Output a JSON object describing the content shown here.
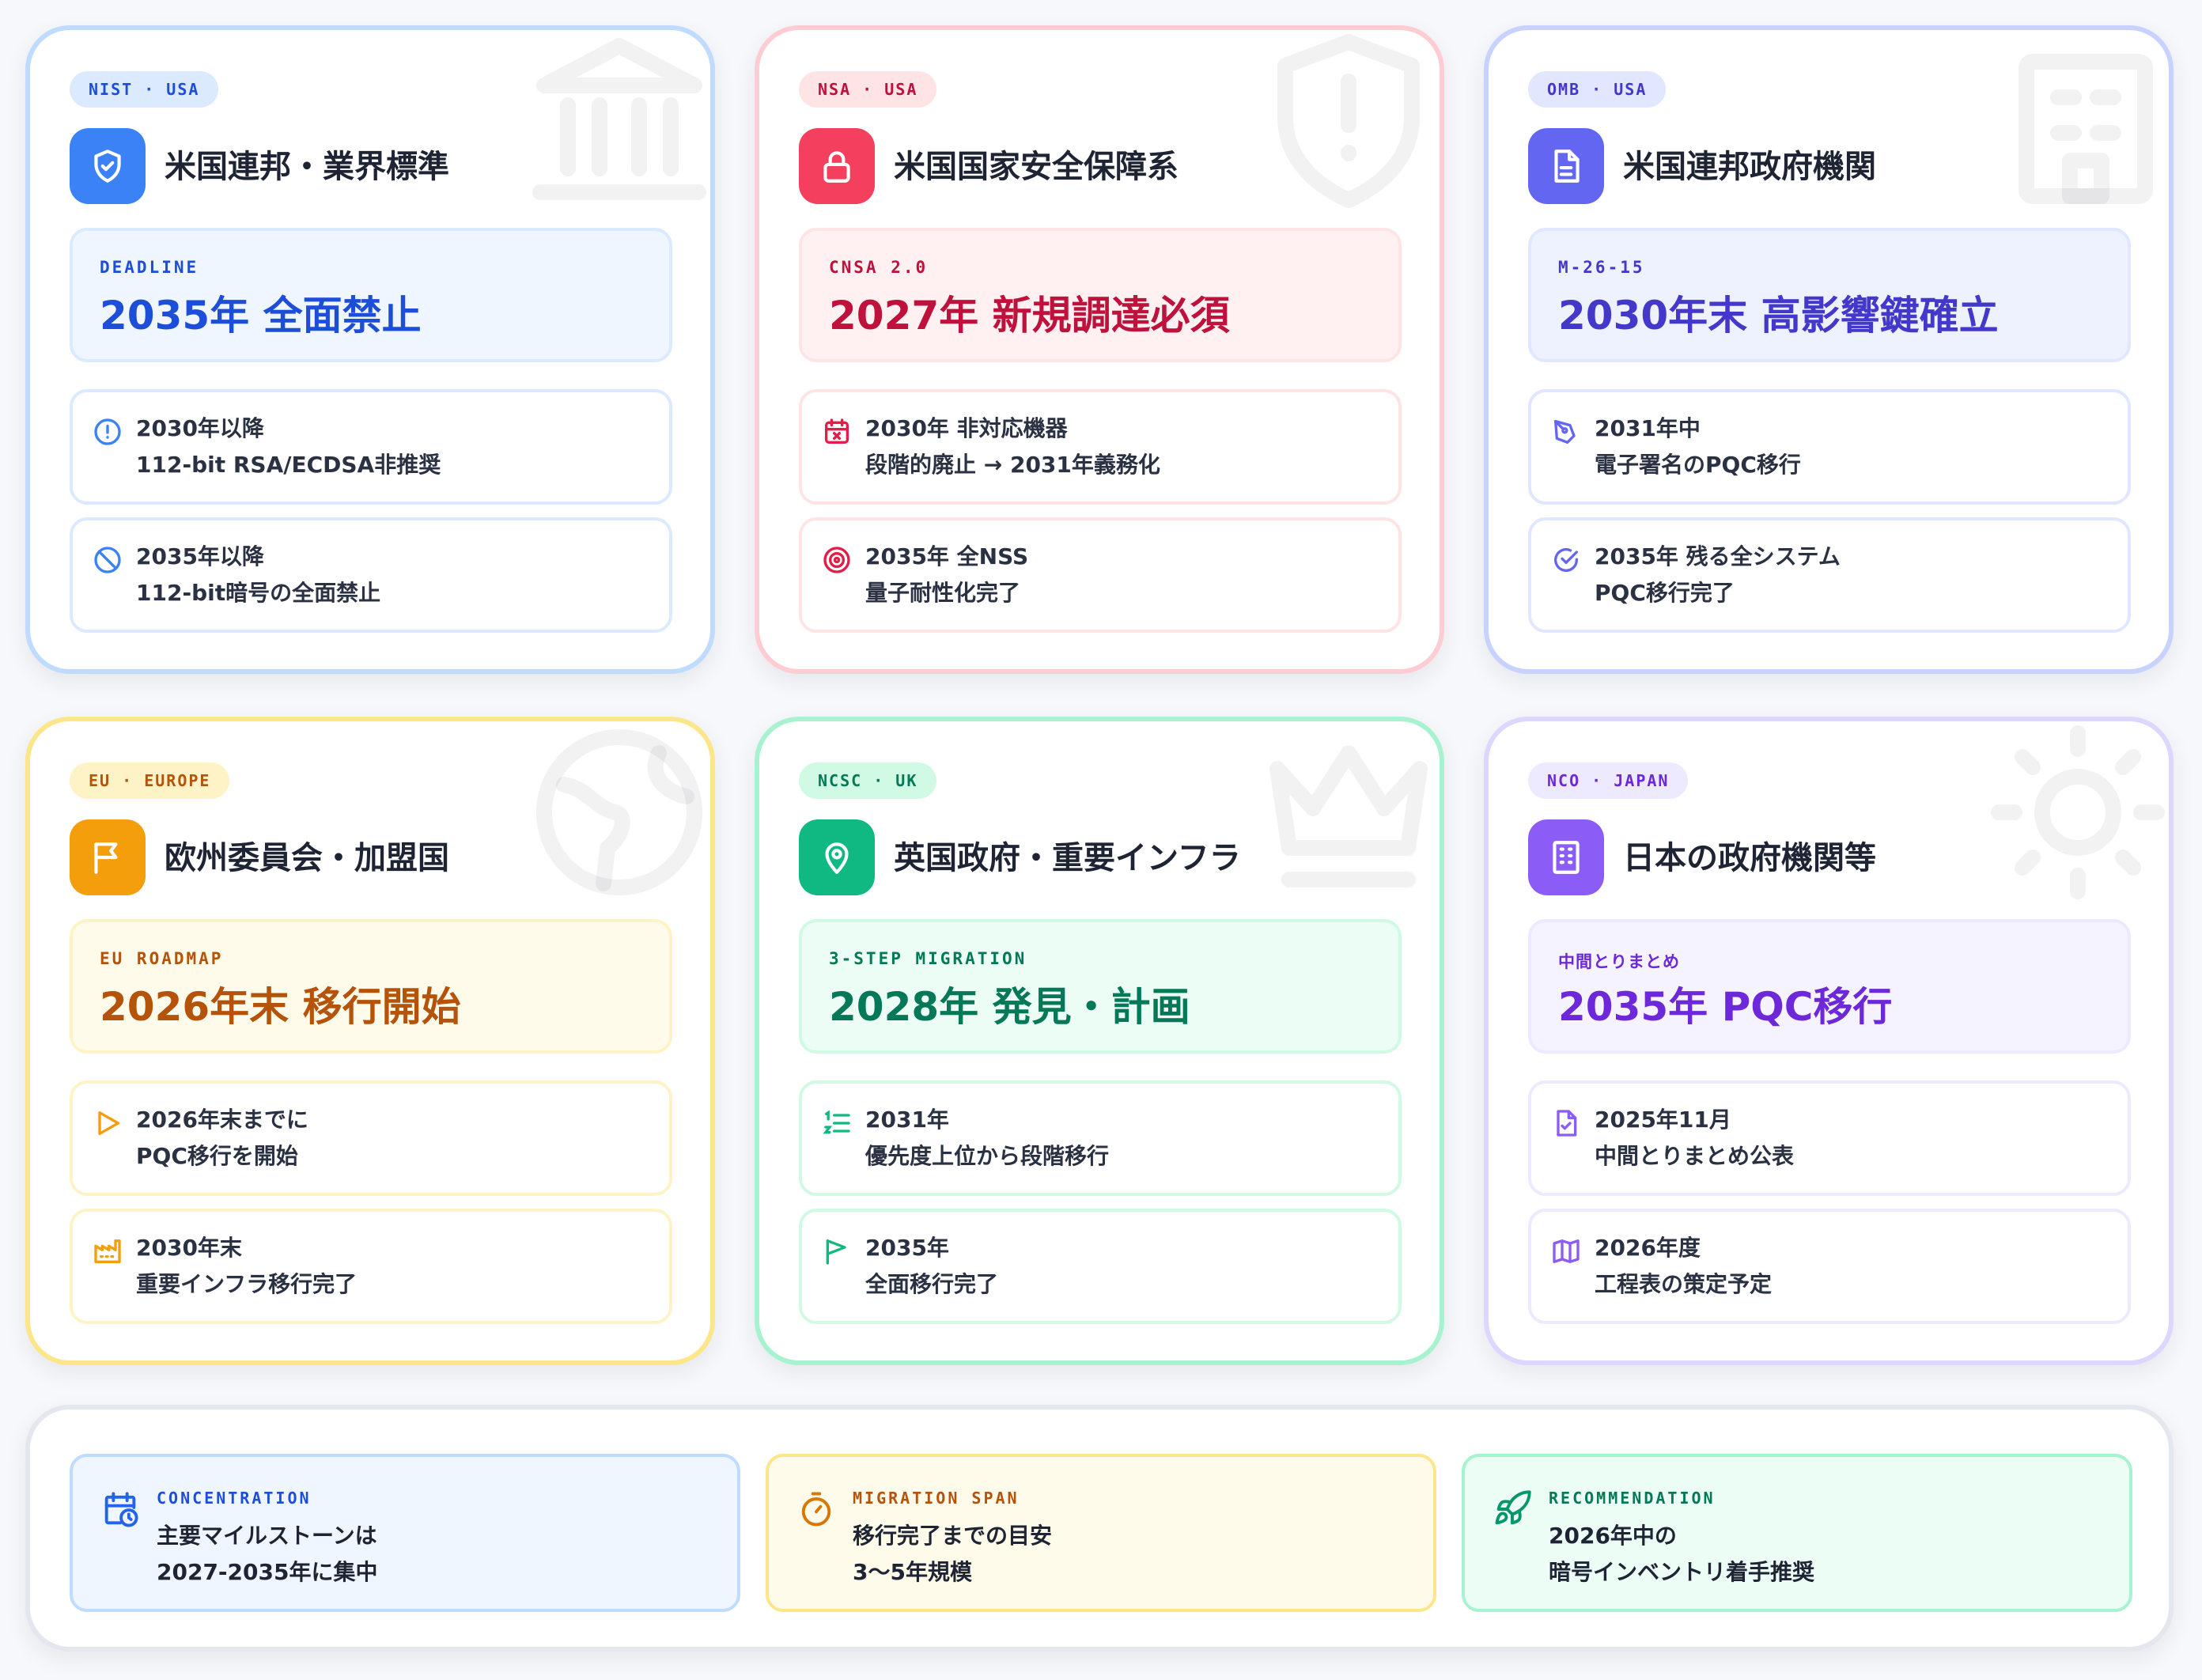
{
  "cards": [
    {
      "badge": "NIST · USA",
      "title": "米国連邦・業界標準",
      "hero_label": "DEADLINE",
      "hero_value": "2035年 全面禁止",
      "items": [
        {
          "icon": "alert-circle-icon",
          "line1": "2030年以降",
          "line2": "112-bit RSA/ECDSA非推奨"
        },
        {
          "icon": "ban-icon",
          "line1": "2035年以降",
          "line2": "112-bit暗号の全面禁止"
        }
      ],
      "head_icon": "shield-check-icon",
      "bg_icon": "institution-icon",
      "accent": "#3b82f6"
    },
    {
      "badge": "NSA · USA",
      "title": "米国国家安全保障系",
      "hero_label": "CNSA 2.0",
      "hero_value": "2027年 新規調達必須",
      "items": [
        {
          "icon": "calendar-x-icon",
          "line1": "2030年 非対応機器",
          "line2": "段階的廃止 → 2031年義務化"
        },
        {
          "icon": "target-icon",
          "line1": "2035年 全NSS",
          "line2": "量子耐性化完了"
        }
      ],
      "head_icon": "lock-icon",
      "bg_icon": "shield-alert-icon",
      "accent": "#f43f5e"
    },
    {
      "badge": "OMB · USA",
      "title": "米国連邦政府機関",
      "hero_label": "M-26-15",
      "hero_value": "2030年末 高影響鍵確立",
      "items": [
        {
          "icon": "pen-signature-icon",
          "line1": "2031年中",
          "line2": "電子署名のPQC移行"
        },
        {
          "icon": "check-circle-icon",
          "line1": "2035年 残る全システム",
          "line2": "PQC移行完了"
        }
      ],
      "head_icon": "document-icon",
      "bg_icon": "office-building-icon",
      "accent": "#6366f1"
    },
    {
      "badge": "EU · EUROPE",
      "title": "欧州委員会・加盟国",
      "hero_label": "EU ROADMAP",
      "hero_value": "2026年末 移行開始",
      "items": [
        {
          "icon": "play-icon",
          "line1": "2026年末までに",
          "line2": "PQC移行を開始"
        },
        {
          "icon": "factory-icon",
          "line1": "2030年末",
          "line2": "重要インフラ移行完了"
        }
      ],
      "head_icon": "flag-icon",
      "bg_icon": "globe-icon",
      "accent": "#f59e0b"
    },
    {
      "badge": "NCSC · UK",
      "title": "英国政府・重要インフラ",
      "hero_label": "3-STEP MIGRATION",
      "hero_value": "2028年 発見・計画",
      "items": [
        {
          "icon": "ordered-list-icon",
          "line1": "2031年",
          "line2": "優先度上位から段階移行"
        },
        {
          "icon": "flag-icon",
          "line1": "2035年",
          "line2": "全面移行完了"
        }
      ],
      "head_icon": "map-pin-icon",
      "bg_icon": "crown-icon",
      "accent": "#10b981"
    },
    {
      "badge": "NCO · JAPAN",
      "title": "日本の政府機関等",
      "hero_label": "中間とりまとめ",
      "hero_value": "2035年 PQC移行",
      "items": [
        {
          "icon": "file-check-icon",
          "line1": "2025年11月",
          "line2": "中間とりまとめ公表"
        },
        {
          "icon": "map-icon",
          "line1": "2026年度",
          "line2": "工程表の策定予定"
        }
      ],
      "head_icon": "building-icon",
      "bg_icon": "sun-icon",
      "accent": "#8b5cf6"
    }
  ],
  "summary": [
    {
      "icon": "calendar-clock-icon",
      "label": "CONCENTRATION",
      "line1": "主要マイルストーンは",
      "line2": "2027-2035年に集中",
      "color": "#1d4ed8"
    },
    {
      "icon": "timer-icon",
      "label": "MIGRATION SPAN",
      "line1": "移行完了までの目安",
      "line2": "3〜5年規模",
      "color": "#b45309"
    },
    {
      "icon": "rocket-icon",
      "label": "RECOMMENDATION",
      "line1": "2026年中の",
      "line2": "暗号インベントリ着手推奨",
      "color": "#047857"
    }
  ]
}
